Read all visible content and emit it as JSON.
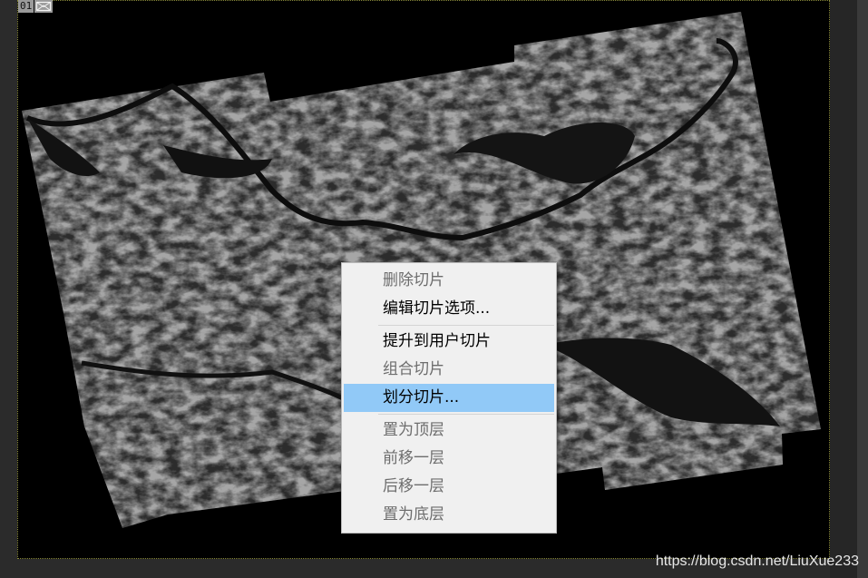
{
  "slice": {
    "number": "01",
    "icon": "image-slice-icon"
  },
  "context_menu": {
    "items": [
      {
        "label": "删除切片",
        "state": "disabled"
      },
      {
        "label": "编辑切片选项...",
        "state": "enabled"
      },
      {
        "separator": true
      },
      {
        "label": "提升到用户切片",
        "state": "enabled"
      },
      {
        "label": "组合切片",
        "state": "disabled"
      },
      {
        "label": "划分切片...",
        "state": "selected"
      },
      {
        "separator": true
      },
      {
        "label": "置为顶层",
        "state": "disabled"
      },
      {
        "label": "前移一层",
        "state": "disabled"
      },
      {
        "label": "后移一层",
        "state": "disabled"
      },
      {
        "label": "置为底层",
        "state": "disabled"
      }
    ]
  },
  "watermark": "https://blog.csdn.net/LiuXue233",
  "colors": {
    "highlight": "#91c9f7",
    "menu_bg": "#f0f0f0",
    "disabled_text": "#6d6d6d",
    "canvas_bg": "#000000"
  }
}
